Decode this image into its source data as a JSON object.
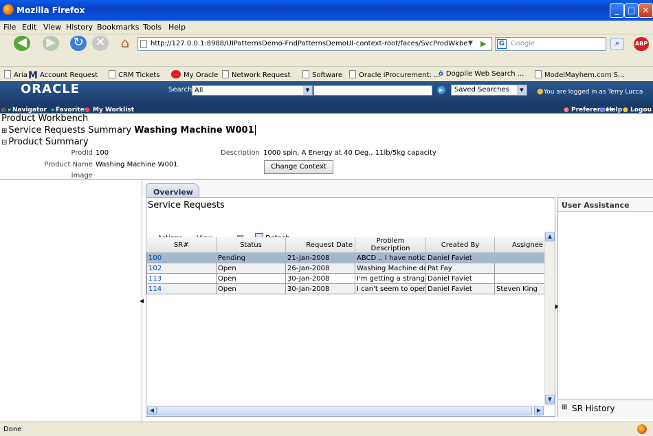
{
  "window": {
    "title": "Mozilla Firefox"
  },
  "menu": [
    "File",
    "Edit",
    "View",
    "History",
    "Bookmarks",
    "Tools",
    "Help"
  ],
  "toolbar": {
    "url": "http://127.0.0.1:8988/UIPatternsDemo-FndPatternsDemoUI-context-root/faces/SvcProdWkbe",
    "search_placeholder": "Google",
    "abp": "ABP"
  },
  "bookmarks": [
    "Aria",
    "Account Request",
    "CRM Tickets",
    "My Oracle",
    "Network Request",
    "Software",
    "Oracle iProcurement: ...",
    "Dogpile Web Search ...",
    "ModelMayhem.com S..."
  ],
  "oracle": {
    "logo": "ORACLE",
    "search_label": "Search",
    "search_scope": "All",
    "saved_searches": "Saved Searches",
    "logged_in": "You are logged in as Terry Lucca",
    "nav_left": [
      "Navigator",
      "Favorites",
      "My Worklist"
    ],
    "nav_right": [
      "Preferences",
      "Help",
      "Logou"
    ]
  },
  "page": {
    "workbench": "Product Workbench",
    "sr_summary_label": "Service Requests Summary",
    "sr_summary_value": "Washing Machine W001",
    "product_summary_label": "Product Summary",
    "prodid_label": "ProdId",
    "prodid_value": "100",
    "product_name_label": "Product Name",
    "product_name_value": "Washing Machine W001",
    "image_label": "Image",
    "description_label": "Description",
    "description_value": "1000 spin, A Energy at 40 Deg., 11lb/5kg capacity",
    "change_context": "Change Context"
  },
  "tabs": {
    "overview": "Overview"
  },
  "service_requests": {
    "title": "Service Requests",
    "actions": "Actions",
    "view": "View",
    "detach": "Detach",
    "columns": [
      "SR#",
      "Status",
      "Request Date",
      "Problem Description",
      "Created By",
      "Assignee"
    ],
    "rows": [
      [
        "100",
        "Pending",
        "21-Jan-2008",
        "ABCD .. I have notice",
        "Daniel Faviet",
        ""
      ],
      [
        "102",
        "Open",
        "26-Jan-2008",
        "Washing Machine doe",
        "Pat Fay",
        ""
      ],
      [
        "113",
        "Open",
        "30-Jan-2008",
        "I'm getting a strange",
        "Daniel Faviet",
        ""
      ],
      [
        "114",
        "Open",
        "30-Jan-2008",
        "I can't seem to open",
        "Daniel Faviet",
        "Steven King"
      ]
    ]
  },
  "user_assistance": {
    "title": "User Assistance",
    "sr_history": "SR History"
  },
  "status": {
    "text": "Done"
  },
  "colors": {
    "oracle_header": "#193b6b",
    "selected_row": "#a7b7cc",
    "link": "#0047ba"
  }
}
